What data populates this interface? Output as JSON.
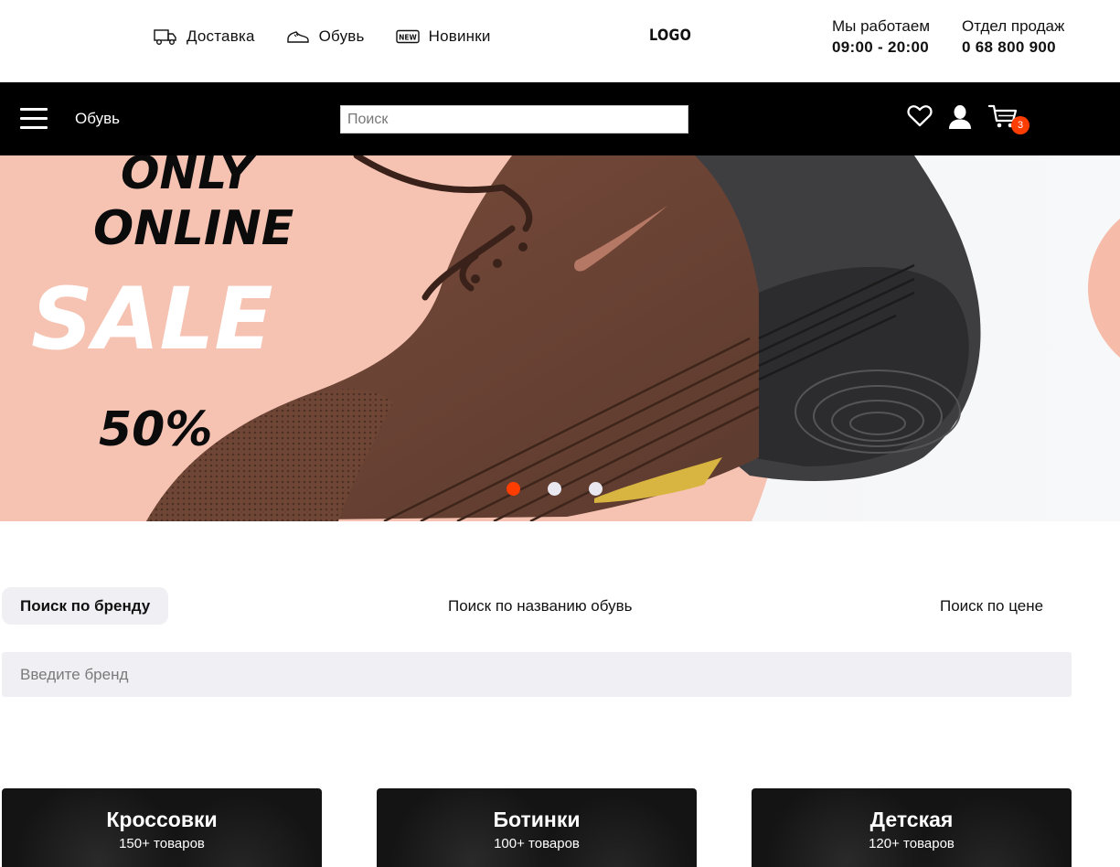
{
  "top_nav": [
    {
      "label": "Доставка",
      "icon": "truck-icon"
    },
    {
      "label": "Обувь",
      "icon": "shoe-icon"
    },
    {
      "label": "Новинки",
      "icon": "new-badge-icon"
    }
  ],
  "new_badge_text": "NEW",
  "logo": "LOGO",
  "hours": {
    "label": "Мы работаем",
    "value": "09:00 - 20:00"
  },
  "sales": {
    "label": "Отдел продаж",
    "value": "0 68 800 900"
  },
  "navbar": {
    "category": "Обувь",
    "search_placeholder": "Поиск",
    "cart_count": "3"
  },
  "hero": {
    "line1": "ONLY",
    "line2": "ONLINE",
    "line3": "SALE",
    "line4": "50%",
    "slides": 3,
    "active_slide": 0
  },
  "search_tabs": [
    {
      "label": "Поиск по бренду",
      "active": true
    },
    {
      "label": "Поиск по названию обувь",
      "active": false
    },
    {
      "label": "Поиск по цене",
      "active": false
    }
  ],
  "brand_input_placeholder": "Введите бренд",
  "categories": [
    {
      "title": "Кроссовки",
      "count": "150+ товаров"
    },
    {
      "title": "Ботинки",
      "count": "100+ товаров"
    },
    {
      "title": "Детская",
      "count": "120+ товаров"
    }
  ],
  "colors": {
    "accent": "#ff3d00",
    "navbar_bg": "#000000",
    "peach": "#f6c3b3",
    "tab_bg": "#efeff4"
  }
}
